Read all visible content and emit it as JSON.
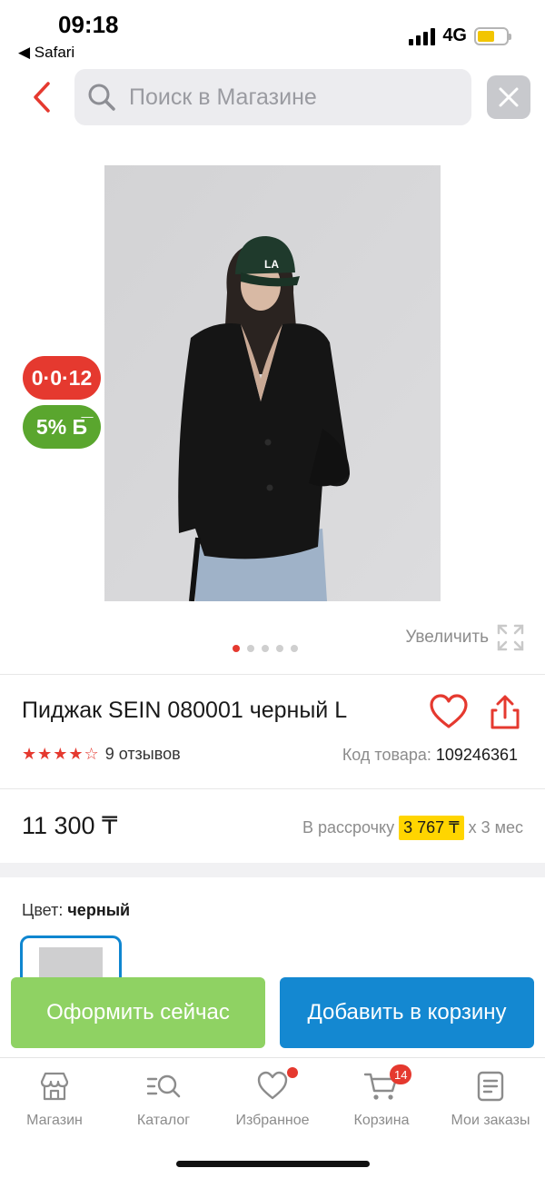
{
  "status_bar": {
    "time": "09:18",
    "back_app": "◀ Safari",
    "network": "4G",
    "battery_level": 0.6
  },
  "search": {
    "placeholder": "Поиск в Магазине"
  },
  "badges": {
    "installment": "0·0·12",
    "bonus": "5% Б̅"
  },
  "gallery": {
    "zoom_label": "Увеличить",
    "total_images": 5,
    "active_index": 0
  },
  "product": {
    "title": "Пиджак SEIN 080001 черный L",
    "rating_stars": "★★★★☆",
    "rating": 4.5,
    "reviews": "9 отзывов",
    "sku_label": "Код товара:",
    "sku_value": "109246361",
    "price": "11 300 ₸",
    "credit_prefix": "В рассрочку",
    "credit_amount": "3 767 ₸",
    "credit_suffix": "х 3 мес",
    "color_label": "Цвет:",
    "color_value": "черный"
  },
  "actions": {
    "order_now": "Оформить сейчас",
    "add_to_cart": "Добавить в корзину"
  },
  "tabbar": [
    {
      "label": "Магазин",
      "icon": "store-icon"
    },
    {
      "label": "Каталог",
      "icon": "catalog-search-icon"
    },
    {
      "label": "Избранное",
      "icon": "heart-icon",
      "dot": true
    },
    {
      "label": "Корзина",
      "icon": "cart-icon",
      "count": "14"
    },
    {
      "label": "Мои заказы",
      "icon": "orders-icon"
    }
  ],
  "colors": {
    "accent_red": "#e5392f",
    "bonus_green": "#5aa62e",
    "order_green": "#8fd263",
    "cart_blue": "#1488d1",
    "credit_yellow": "#ffd500"
  }
}
